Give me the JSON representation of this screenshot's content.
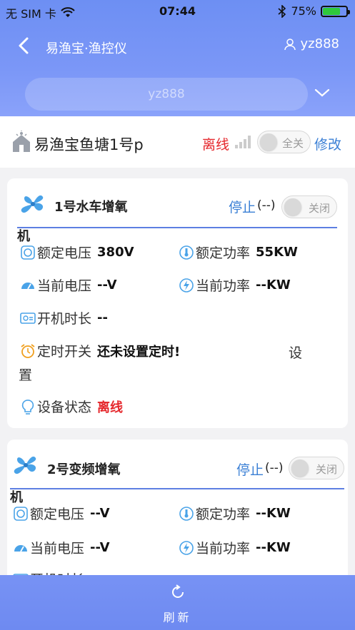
{
  "status": {
    "carrier": "无 SIM 卡",
    "time": "07:44",
    "battery": "75%",
    "battery_level": 0.75
  },
  "nav": {
    "title": "易渔宝·渔控仪",
    "user": "yz888"
  },
  "select": {
    "value": "yz888"
  },
  "pond": {
    "name": "易渔宝鱼塘1号p",
    "status": "离线",
    "toggle_label": "全关",
    "edit_label": "修改"
  },
  "devices": [
    {
      "name_line1": "1号水车增氧",
      "name_line2": "机",
      "stop_label": "停止",
      "state": "(--)",
      "toggle_label": "关闭",
      "rated_voltage_label": "额定电压",
      "rated_voltage": "380V",
      "rated_power_label": "额定功率",
      "rated_power": "55KW",
      "current_voltage_label": "当前电压",
      "current_voltage": "--V",
      "current_power_label": "当前功率",
      "current_power": "--KW",
      "runtime_label": "开机时长",
      "runtime": "--",
      "timer_label": "定时开关",
      "timer": "还未设置定时!",
      "setup_label_1": "设",
      "setup_label_2": "置",
      "device_status_label": "设备状态",
      "device_status": "离线"
    },
    {
      "name_line1": "2号变频增氧",
      "name_line2": "机",
      "stop_label": "停止",
      "state": "(--)",
      "toggle_label": "关闭",
      "rated_voltage_label": "额定电压",
      "rated_voltage": "--V",
      "rated_power_label": "额定功率",
      "rated_power": "--KW",
      "current_voltage_label": "当前电压",
      "current_voltage": "--V",
      "current_power_label": "当前功率",
      "current_power": "--KW",
      "runtime_label": "开机时长"
    }
  ],
  "bottom": {
    "refresh_label": "刷新"
  },
  "colors": {
    "accent": "#6d8ff3",
    "offline": "#e5262b",
    "link": "#3a7fd5"
  }
}
